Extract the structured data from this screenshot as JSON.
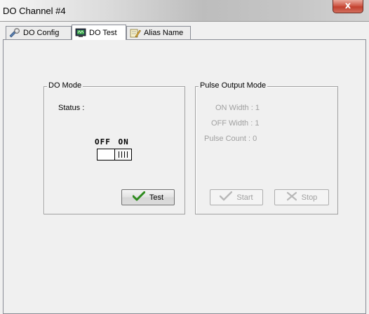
{
  "window": {
    "title": "DO Channel #4",
    "close_glyph": "x"
  },
  "tabs": [
    {
      "label": "DO Config",
      "icon": "gear-icon",
      "active": false
    },
    {
      "label": "DO Test",
      "icon": "monitor-icon",
      "active": true
    },
    {
      "label": "Alias Name",
      "icon": "edit-icon",
      "active": false
    }
  ],
  "do_mode": {
    "legend": "DO Mode",
    "status_label": "Status :",
    "off_label": "OFF",
    "on_label": "ON",
    "switch_state": "ON",
    "test_button": "Test"
  },
  "pulse_output": {
    "legend": "Pulse Output Mode",
    "on_width": "ON Width : 1",
    "off_width": "OFF Width : 1",
    "pulse_count": "Pulse Count : 0",
    "start_button": "Start",
    "stop_button": "Stop"
  },
  "colors": {
    "check_green": "#2e8b1e",
    "close_red": "#c2402e"
  }
}
